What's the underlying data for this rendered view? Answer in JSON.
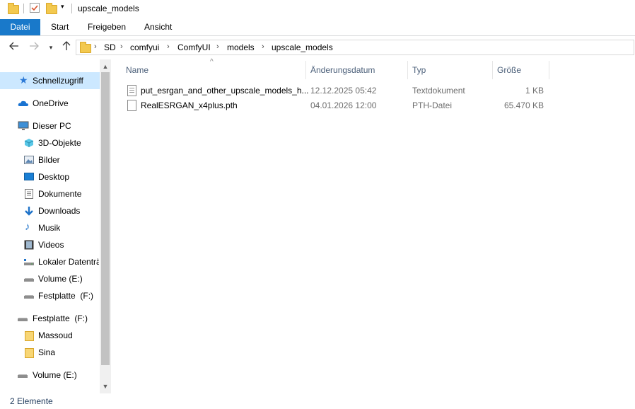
{
  "window": {
    "title": "upscale_models"
  },
  "ribbon": {
    "tabs": [
      {
        "label": "Datei",
        "active": true
      },
      {
        "label": "Start"
      },
      {
        "label": "Freigeben"
      },
      {
        "label": "Ansicht"
      }
    ]
  },
  "address": {
    "crumbs": [
      "SD",
      "comfyui",
      "ComfyUI",
      "models",
      "upscale_models"
    ]
  },
  "sidebar": {
    "items": [
      {
        "label": "Schnellzugriff",
        "icon": "star-icon",
        "selected": true
      },
      {
        "label": "OneDrive",
        "icon": "cloud-icon"
      },
      {
        "label": "Dieser PC",
        "icon": "pc-icon"
      },
      {
        "label": "3D-Objekte",
        "icon": "cube-icon"
      },
      {
        "label": "Bilder",
        "icon": "pictures-icon"
      },
      {
        "label": "Desktop",
        "icon": "desktop-icon"
      },
      {
        "label": "Dokumente",
        "icon": "documents-icon"
      },
      {
        "label": "Downloads",
        "icon": "download-icon"
      },
      {
        "label": "Musik",
        "icon": "music-icon"
      },
      {
        "label": "Videos",
        "icon": "video-icon"
      },
      {
        "label": "Lokaler Datenträ",
        "icon": "drive-icon"
      },
      {
        "label": "Volume (E:)",
        "icon": "drive-icon"
      },
      {
        "label": "Festplatte  (F:)",
        "icon": "drive-icon"
      },
      {
        "label": "Festplatte  (F:)",
        "icon": "drive-icon"
      },
      {
        "label": "Massoud",
        "icon": "folder-icon"
      },
      {
        "label": "Sina",
        "icon": "folder-icon"
      },
      {
        "label": "Volume (E:)",
        "icon": "drive-icon"
      }
    ]
  },
  "columns": {
    "name": "Name",
    "date": "Änderungsdatum",
    "type": "Typ",
    "size": "Größe"
  },
  "files": [
    {
      "name": "put_esrgan_and_other_upscale_models_h...",
      "date": "12.12.2025 05:42",
      "type": "Textdokument",
      "size": "1 KB",
      "icon": "text-file-icon"
    },
    {
      "name": "RealESRGAN_x4plus.pth",
      "date": "04.01.2026 12:00",
      "type": "PTH-Datei",
      "size": "65.470 KB",
      "icon": "file-icon"
    }
  ],
  "status": {
    "text": "2 Elemente"
  },
  "colors": {
    "accent": "#1979ca",
    "selection": "#cce8ff",
    "folder": "#f3c94f"
  }
}
